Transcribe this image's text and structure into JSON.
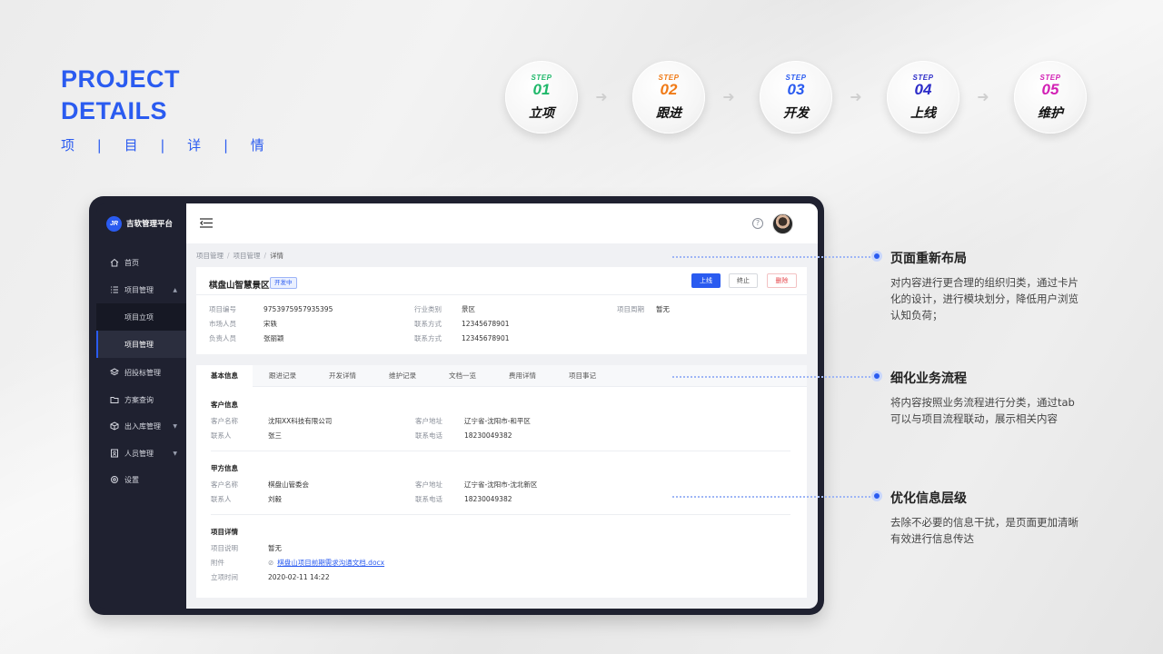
{
  "header": {
    "title_line1": "PROJECT",
    "title_line2": "DETAILS",
    "subtitle": "项 | 目 | 详 | 情"
  },
  "steps": [
    {
      "label": "STEP",
      "num": "01",
      "name": "立项",
      "color": "#1fb86a"
    },
    {
      "label": "STEP",
      "num": "02",
      "name": "跟进",
      "color": "#f07a16"
    },
    {
      "label": "STEP",
      "num": "03",
      "name": "开发",
      "color": "#2a5bf0"
    },
    {
      "label": "STEP",
      "num": "04",
      "name": "上线",
      "color": "#2c2cc8"
    },
    {
      "label": "STEP",
      "num": "05",
      "name": "维护",
      "color": "#d21fb4"
    }
  ],
  "app": {
    "logo": "JR",
    "name": "吉软管理平台",
    "nav": [
      {
        "label": "首页",
        "icon": "home-icon"
      },
      {
        "label": "项目管理",
        "icon": "list-icon",
        "expanded": true
      },
      {
        "label": "项目立项",
        "sub": true
      },
      {
        "label": "项目管理",
        "sub": true,
        "active": true
      },
      {
        "label": "招投标管理",
        "icon": "layers-icon"
      },
      {
        "label": "方案查询",
        "icon": "folder-icon"
      },
      {
        "label": "出入库管理",
        "icon": "box-icon"
      },
      {
        "label": "人员管理",
        "icon": "badge-icon"
      },
      {
        "label": "设置",
        "icon": "gear-icon"
      }
    ]
  },
  "breadcrumb": [
    "项目管理",
    "项目管理",
    "详情"
  ],
  "project": {
    "name": "棋盘山智慧景区",
    "status": "开发中",
    "buttons": {
      "online": "上线",
      "stop": "终止",
      "delete": "删除"
    },
    "fields": {
      "code_label": "项目编号",
      "code": "9753975957935395",
      "industry_label": "行业类别",
      "industry": "景区",
      "period_label": "项目周期",
      "period": "暂无",
      "market_label": "市场人员",
      "market": "宋轶",
      "contact1_label": "联系方式",
      "contact1": "12345678901",
      "owner_label": "负责人员",
      "owner": "张丽颖",
      "contact2_label": "联系方式",
      "contact2": "12345678901"
    }
  },
  "tabs": [
    "基本信息",
    "跟进记录",
    "开发详情",
    "维护记录",
    "文档一览",
    "费用详情",
    "项目事记"
  ],
  "customer": {
    "title": "客户信息",
    "name_label": "客户名称",
    "name": "沈阳XX科技有限公司",
    "addr_label": "客户地址",
    "addr": "辽宁省-沈阳市-和平区",
    "contact_label": "联系人",
    "contact": "张三",
    "phone_label": "联系电话",
    "phone": "18230049382"
  },
  "party_a": {
    "title": "甲方信息",
    "name_label": "客户名称",
    "name": "棋盘山管委会",
    "addr_label": "客户地址",
    "addr": "辽宁省-沈阳市-沈北新区",
    "contact_label": "联系人",
    "contact": "刘毅",
    "phone_label": "联系电话",
    "phone": "18230049382"
  },
  "detail": {
    "title": "项目详情",
    "desc_label": "项目说明",
    "desc": "暂无",
    "attach_label": "附件",
    "attach": "棋盘山项目前期需求沟通文档.docx",
    "time_label": "立项时间",
    "time": "2020-02-11 14:22"
  },
  "annotations": [
    {
      "title": "页面重新布局",
      "desc": "对内容进行更合理的组织归类，通过卡片化的设计，进行模块划分，降低用户浏览认知负荷；"
    },
    {
      "title": "细化业务流程",
      "desc": "将内容按照业务流程进行分类，通过tab可以与项目流程联动，展示相关内容"
    },
    {
      "title": "优化信息层级",
      "desc": "去除不必要的信息干扰，是页面更加清晰有效进行信息传达"
    }
  ]
}
